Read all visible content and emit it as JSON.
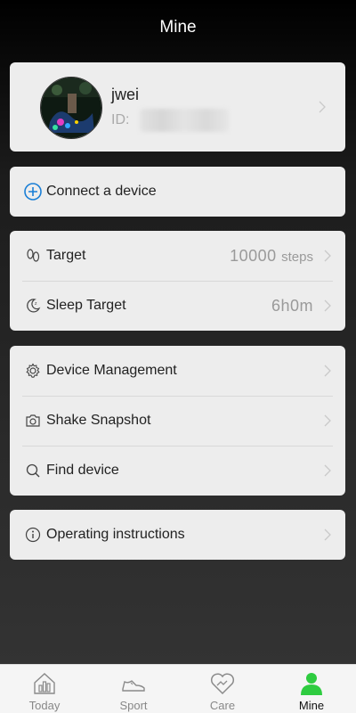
{
  "header": {
    "title": "Mine"
  },
  "profile": {
    "username": "jwei",
    "id_label": "ID:"
  },
  "connect": {
    "label": "Connect a device"
  },
  "targets": {
    "step_label": "Target",
    "step_value": "10000",
    "step_unit": "steps",
    "sleep_label": "Sleep Target",
    "sleep_value": "6h0m"
  },
  "tools": {
    "device_management": "Device Management",
    "shake_snapshot": "Shake Snapshot",
    "find_device": "Find device"
  },
  "instructions": {
    "label": "Operating instructions"
  },
  "tabs": [
    {
      "label": "Today",
      "icon": "bar-chart-house-icon"
    },
    {
      "label": "Sport",
      "icon": "sneaker-icon"
    },
    {
      "label": "Care",
      "icon": "heart-handshake-icon"
    },
    {
      "label": "Mine",
      "icon": "person-icon",
      "active": true
    }
  ],
  "colors": {
    "accent_blue": "#1a7fd6",
    "active_green": "#2ecc40"
  }
}
